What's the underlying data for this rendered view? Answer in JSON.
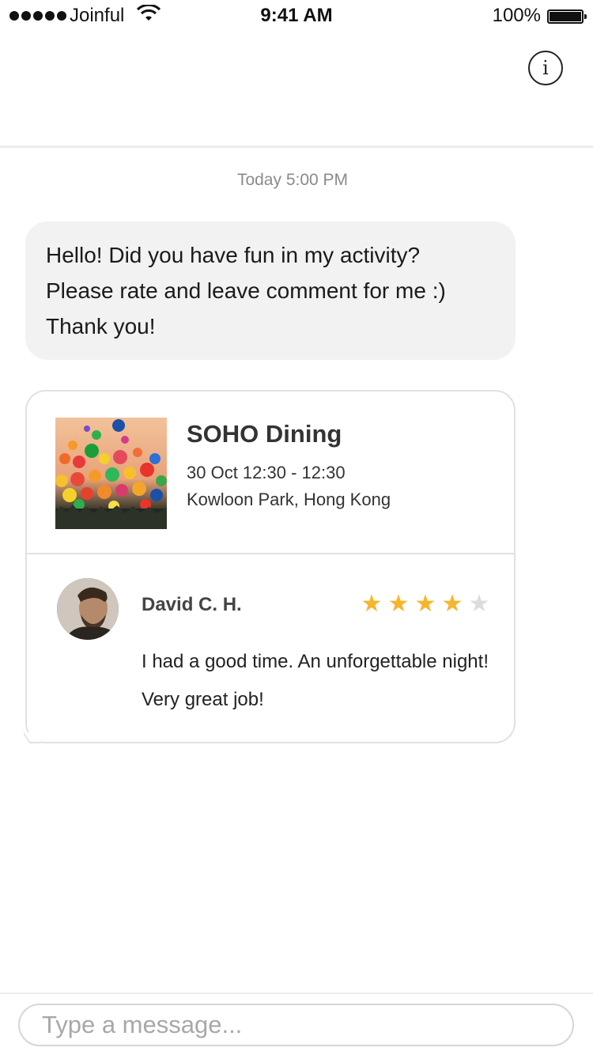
{
  "status_bar": {
    "carrier": "Joinful",
    "time": "9:41 AM",
    "battery": "100%"
  },
  "header": {
    "info_icon": "info-icon",
    "info_glyph": "i"
  },
  "chat": {
    "timestamp": "Today 5:00 PM",
    "message_lines": [
      "Hello! Did you have fun in my activity?",
      "Please rate and leave comment for me :)",
      "Thank you!"
    ]
  },
  "activity_card": {
    "title": "SOHO Dining",
    "datetime": "30 Oct 12:30 - 12:30",
    "location": "Kowloon Park, Hong Kong",
    "review": {
      "reviewer": "David C. H.",
      "rating": 4,
      "max_rating": 5,
      "star_color_filled": "#f7b52c",
      "star_color_empty": "#dcdcdc",
      "text": "I had a good time. An unforgettable night! Very great job!"
    }
  },
  "composer": {
    "placeholder": "Type a message..."
  }
}
